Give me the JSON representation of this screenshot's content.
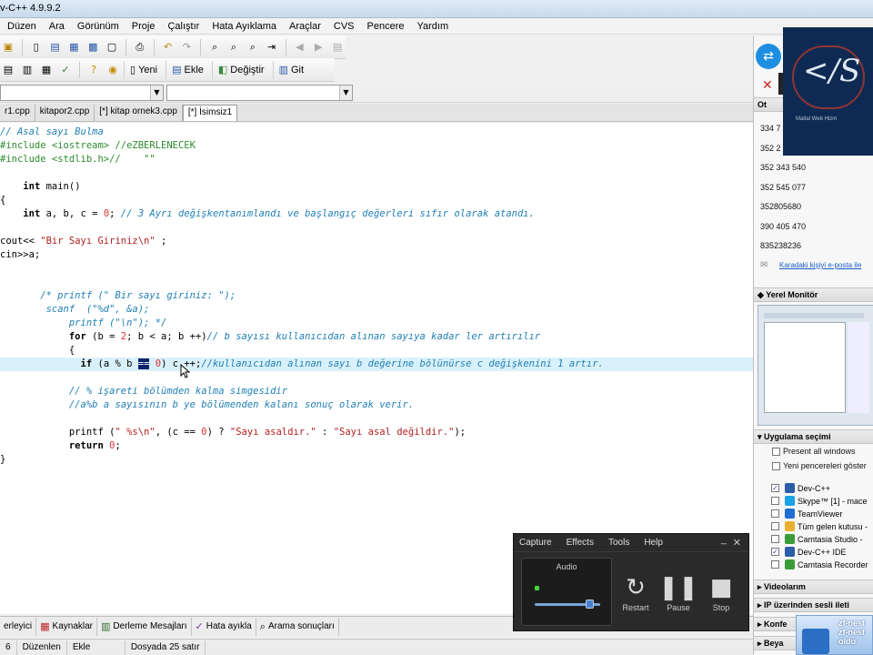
{
  "window": {
    "title": "v-C++ 4.9.9.2"
  },
  "menu": [
    "Düzen",
    "Ara",
    "Görünüm",
    "Proje",
    "Çalıştır",
    "Hata Ayıklama",
    "Araçlar",
    "CVS",
    "Pencere",
    "Yardım"
  ],
  "toolbar2_buttons": [
    {
      "icon": "new-doc-icon",
      "label": "Yeni"
    },
    {
      "icon": "insert-icon",
      "label": "Ekle"
    },
    {
      "icon": "toggle-icon",
      "label": "Değiştir"
    },
    {
      "icon": "goto-icon",
      "label": "Git"
    }
  ],
  "tabs": [
    {
      "label": "r1.cpp",
      "active": false
    },
    {
      "label": "kitapor2.cpp",
      "active": false
    },
    {
      "label": "[*] kitap ornek3.cpp",
      "active": false
    },
    {
      "label": "[*] İsimsiz1",
      "active": true
    }
  ],
  "code_lines": [
    "// Asal sayı Bulma",
    "#include <iostream> //eZBERLENECEK",
    "#include <stdlib.h>//    \"\"",
    "",
    "    int main()",
    "{",
    "    int a, b, c = 0; // 3 Ayrı değişkentanımlandı ve başlangıç değerleri sıfır olarak atandı.",
    "",
    "cout<< \"Bir Sayı Giriniz\\n\" ;",
    "cin>>a;",
    "",
    "",
    "       /* printf (\" Bir sayı giriniz: \");",
    "        scanf  (\"%d\", &a);",
    "            printf (\"\\n\"); */",
    "            for (b = 2; b < a; b ++)// b sayısı kullanıcıdan alınan sayıya kadar ler artırılır",
    "            {",
    "              if (a % b == 0) c ++;//kullanıcıdan alınan sayı b değerine bölünürse c değişkenini 1 artır.",
    "            // % işareti bölümden kalma simgesidir",
    "            //a%b a sayısının b ye bölümenden kalanı sonuç olarak verir.",
    "",
    "            printf (\" %s\\n\", (c == 0) ? \"Sayı asaldır.\" : \"Sayı asal değildir.\");",
    "            return 0;",
    "}"
  ],
  "bottom_tabs": [
    {
      "icon": "compiler-icon",
      "label": "erleyici"
    },
    {
      "icon": "resources-icon",
      "label": "Kaynaklar"
    },
    {
      "icon": "compile-log-icon",
      "label": "Derleme Mesajları"
    },
    {
      "icon": "debug-icon",
      "label": "Hata ayıkla"
    },
    {
      "icon": "find-results-icon",
      "label": "Arama sonuçları"
    }
  ],
  "status": {
    "line": "6",
    "state": "Düzenlen",
    "mode": "Ekle",
    "info": "Dosyada 25 satır"
  },
  "right_panel": {
    "section_top": "Ot",
    "numbers": [
      "334 7",
      "352 2",
      "352 343 540",
      "352 545 077",
      "352805680",
      "390 405 470",
      "835238236"
    ],
    "link": "Karadaki kişiyi e-posta ile",
    "yerel_monitor": "Yerel Monitör",
    "uygulama": "Uygulama seçimi",
    "present_all": "Present all windows",
    "yeni_pencereler": "Yeni pencereleri göster",
    "apps": [
      {
        "label": "Dev-C++",
        "checked": true,
        "color": "#2b5da8"
      },
      {
        "label": "Skype™ [1] - mace",
        "checked": false,
        "color": "#1aa3e6"
      },
      {
        "label": "TeamViewer",
        "checked": false,
        "color": "#1e6fcf"
      },
      {
        "label": "Tüm gelen kutusu -",
        "checked": false,
        "color": "#e9b030"
      },
      {
        "label": "Camtasia Studio -",
        "checked": false,
        "color": "#3a9d3a"
      },
      {
        "label": "Dev-C++ IDE",
        "checked": true,
        "color": "#2b5da8"
      },
      {
        "label": "Camtasia Recorder",
        "checked": false,
        "color": "#3a9d3a"
      }
    ],
    "videolarim": "Videolarım",
    "ip_sesli": "IP üzerinden sesli ileti",
    "konf": "Konfe",
    "beya": "Beya"
  },
  "logo": {
    "text": "</S",
    "sub": "Maltal Web Hizm"
  },
  "camtasia": {
    "menu": [
      "Capture",
      "Effects",
      "Tools",
      "Help"
    ],
    "audio_label": "Audio",
    "audio_level": 0.85,
    "buttons": [
      {
        "icon": "restart-icon",
        "label": "Restart"
      },
      {
        "icon": "pause-icon",
        "label": "Pause"
      },
      {
        "icon": "stop-icon",
        "label": "Stop"
      }
    ]
  },
  "notify": {
    "line1": "zf-nest",
    "line2": "zf-nest",
    "line3": "oldu"
  }
}
